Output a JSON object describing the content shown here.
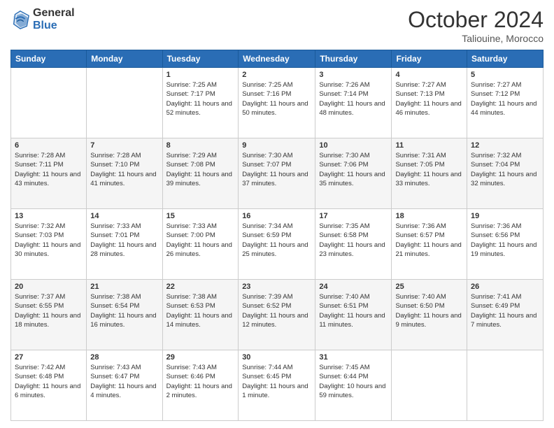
{
  "header": {
    "logo_general": "General",
    "logo_blue": "Blue",
    "month_title": "October 2024",
    "location": "Taliouine, Morocco"
  },
  "weekdays": [
    "Sunday",
    "Monday",
    "Tuesday",
    "Wednesday",
    "Thursday",
    "Friday",
    "Saturday"
  ],
  "weeks": [
    [
      {
        "day": "",
        "sunrise": "",
        "sunset": "",
        "daylight": ""
      },
      {
        "day": "",
        "sunrise": "",
        "sunset": "",
        "daylight": ""
      },
      {
        "day": "1",
        "sunrise": "Sunrise: 7:25 AM",
        "sunset": "Sunset: 7:17 PM",
        "daylight": "Daylight: 11 hours and 52 minutes."
      },
      {
        "day": "2",
        "sunrise": "Sunrise: 7:25 AM",
        "sunset": "Sunset: 7:16 PM",
        "daylight": "Daylight: 11 hours and 50 minutes."
      },
      {
        "day": "3",
        "sunrise": "Sunrise: 7:26 AM",
        "sunset": "Sunset: 7:14 PM",
        "daylight": "Daylight: 11 hours and 48 minutes."
      },
      {
        "day": "4",
        "sunrise": "Sunrise: 7:27 AM",
        "sunset": "Sunset: 7:13 PM",
        "daylight": "Daylight: 11 hours and 46 minutes."
      },
      {
        "day": "5",
        "sunrise": "Sunrise: 7:27 AM",
        "sunset": "Sunset: 7:12 PM",
        "daylight": "Daylight: 11 hours and 44 minutes."
      }
    ],
    [
      {
        "day": "6",
        "sunrise": "Sunrise: 7:28 AM",
        "sunset": "Sunset: 7:11 PM",
        "daylight": "Daylight: 11 hours and 43 minutes."
      },
      {
        "day": "7",
        "sunrise": "Sunrise: 7:28 AM",
        "sunset": "Sunset: 7:10 PM",
        "daylight": "Daylight: 11 hours and 41 minutes."
      },
      {
        "day": "8",
        "sunrise": "Sunrise: 7:29 AM",
        "sunset": "Sunset: 7:08 PM",
        "daylight": "Daylight: 11 hours and 39 minutes."
      },
      {
        "day": "9",
        "sunrise": "Sunrise: 7:30 AM",
        "sunset": "Sunset: 7:07 PM",
        "daylight": "Daylight: 11 hours and 37 minutes."
      },
      {
        "day": "10",
        "sunrise": "Sunrise: 7:30 AM",
        "sunset": "Sunset: 7:06 PM",
        "daylight": "Daylight: 11 hours and 35 minutes."
      },
      {
        "day": "11",
        "sunrise": "Sunrise: 7:31 AM",
        "sunset": "Sunset: 7:05 PM",
        "daylight": "Daylight: 11 hours and 33 minutes."
      },
      {
        "day": "12",
        "sunrise": "Sunrise: 7:32 AM",
        "sunset": "Sunset: 7:04 PM",
        "daylight": "Daylight: 11 hours and 32 minutes."
      }
    ],
    [
      {
        "day": "13",
        "sunrise": "Sunrise: 7:32 AM",
        "sunset": "Sunset: 7:03 PM",
        "daylight": "Daylight: 11 hours and 30 minutes."
      },
      {
        "day": "14",
        "sunrise": "Sunrise: 7:33 AM",
        "sunset": "Sunset: 7:01 PM",
        "daylight": "Daylight: 11 hours and 28 minutes."
      },
      {
        "day": "15",
        "sunrise": "Sunrise: 7:33 AM",
        "sunset": "Sunset: 7:00 PM",
        "daylight": "Daylight: 11 hours and 26 minutes."
      },
      {
        "day": "16",
        "sunrise": "Sunrise: 7:34 AM",
        "sunset": "Sunset: 6:59 PM",
        "daylight": "Daylight: 11 hours and 25 minutes."
      },
      {
        "day": "17",
        "sunrise": "Sunrise: 7:35 AM",
        "sunset": "Sunset: 6:58 PM",
        "daylight": "Daylight: 11 hours and 23 minutes."
      },
      {
        "day": "18",
        "sunrise": "Sunrise: 7:36 AM",
        "sunset": "Sunset: 6:57 PM",
        "daylight": "Daylight: 11 hours and 21 minutes."
      },
      {
        "day": "19",
        "sunrise": "Sunrise: 7:36 AM",
        "sunset": "Sunset: 6:56 PM",
        "daylight": "Daylight: 11 hours and 19 minutes."
      }
    ],
    [
      {
        "day": "20",
        "sunrise": "Sunrise: 7:37 AM",
        "sunset": "Sunset: 6:55 PM",
        "daylight": "Daylight: 11 hours and 18 minutes."
      },
      {
        "day": "21",
        "sunrise": "Sunrise: 7:38 AM",
        "sunset": "Sunset: 6:54 PM",
        "daylight": "Daylight: 11 hours and 16 minutes."
      },
      {
        "day": "22",
        "sunrise": "Sunrise: 7:38 AM",
        "sunset": "Sunset: 6:53 PM",
        "daylight": "Daylight: 11 hours and 14 minutes."
      },
      {
        "day": "23",
        "sunrise": "Sunrise: 7:39 AM",
        "sunset": "Sunset: 6:52 PM",
        "daylight": "Daylight: 11 hours and 12 minutes."
      },
      {
        "day": "24",
        "sunrise": "Sunrise: 7:40 AM",
        "sunset": "Sunset: 6:51 PM",
        "daylight": "Daylight: 11 hours and 11 minutes."
      },
      {
        "day": "25",
        "sunrise": "Sunrise: 7:40 AM",
        "sunset": "Sunset: 6:50 PM",
        "daylight": "Daylight: 11 hours and 9 minutes."
      },
      {
        "day": "26",
        "sunrise": "Sunrise: 7:41 AM",
        "sunset": "Sunset: 6:49 PM",
        "daylight": "Daylight: 11 hours and 7 minutes."
      }
    ],
    [
      {
        "day": "27",
        "sunrise": "Sunrise: 7:42 AM",
        "sunset": "Sunset: 6:48 PM",
        "daylight": "Daylight: 11 hours and 6 minutes."
      },
      {
        "day": "28",
        "sunrise": "Sunrise: 7:43 AM",
        "sunset": "Sunset: 6:47 PM",
        "daylight": "Daylight: 11 hours and 4 minutes."
      },
      {
        "day": "29",
        "sunrise": "Sunrise: 7:43 AM",
        "sunset": "Sunset: 6:46 PM",
        "daylight": "Daylight: 11 hours and 2 minutes."
      },
      {
        "day": "30",
        "sunrise": "Sunrise: 7:44 AM",
        "sunset": "Sunset: 6:45 PM",
        "daylight": "Daylight: 11 hours and 1 minute."
      },
      {
        "day": "31",
        "sunrise": "Sunrise: 7:45 AM",
        "sunset": "Sunset: 6:44 PM",
        "daylight": "Daylight: 10 hours and 59 minutes."
      },
      {
        "day": "",
        "sunrise": "",
        "sunset": "",
        "daylight": ""
      },
      {
        "day": "",
        "sunrise": "",
        "sunset": "",
        "daylight": ""
      }
    ]
  ]
}
